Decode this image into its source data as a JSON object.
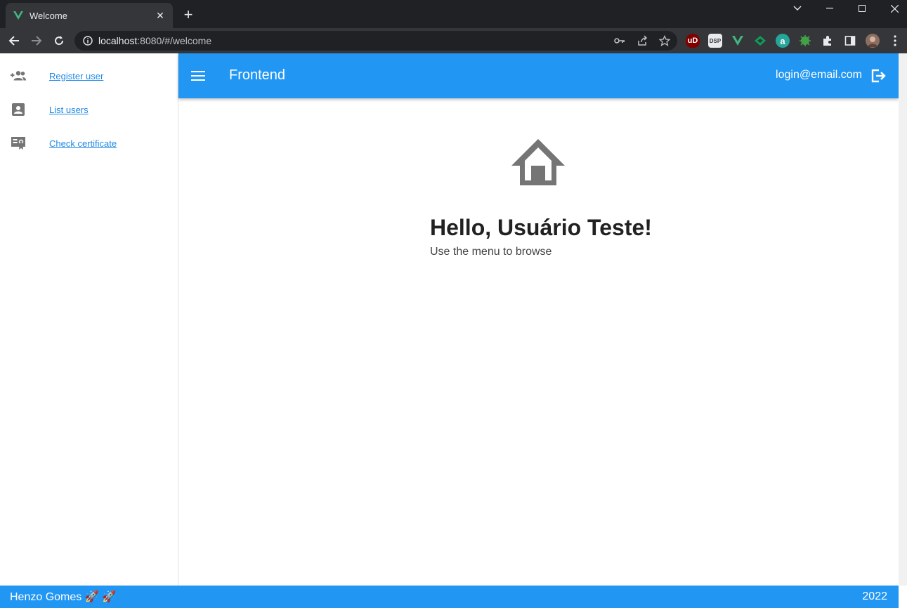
{
  "browser": {
    "tab_title": "Welcome",
    "url_host": "localhost",
    "url_rest": ":8080/#/welcome",
    "accent": "#41b883"
  },
  "sidebar": {
    "items": [
      {
        "label": "Register user",
        "icon": "add-group-icon"
      },
      {
        "label": "List users",
        "icon": "contact-card-icon"
      },
      {
        "label": "Check certificate",
        "icon": "certificate-icon"
      }
    ]
  },
  "appbar": {
    "title": "Frontend",
    "user_email": "login@email.com",
    "color": "#2196f3"
  },
  "main": {
    "greeting": "Hello, Usuário Teste!",
    "subtitle": "Use the menu to browse"
  },
  "footer": {
    "author": "Henzo Gomes 🚀 🚀",
    "year": "2022"
  }
}
